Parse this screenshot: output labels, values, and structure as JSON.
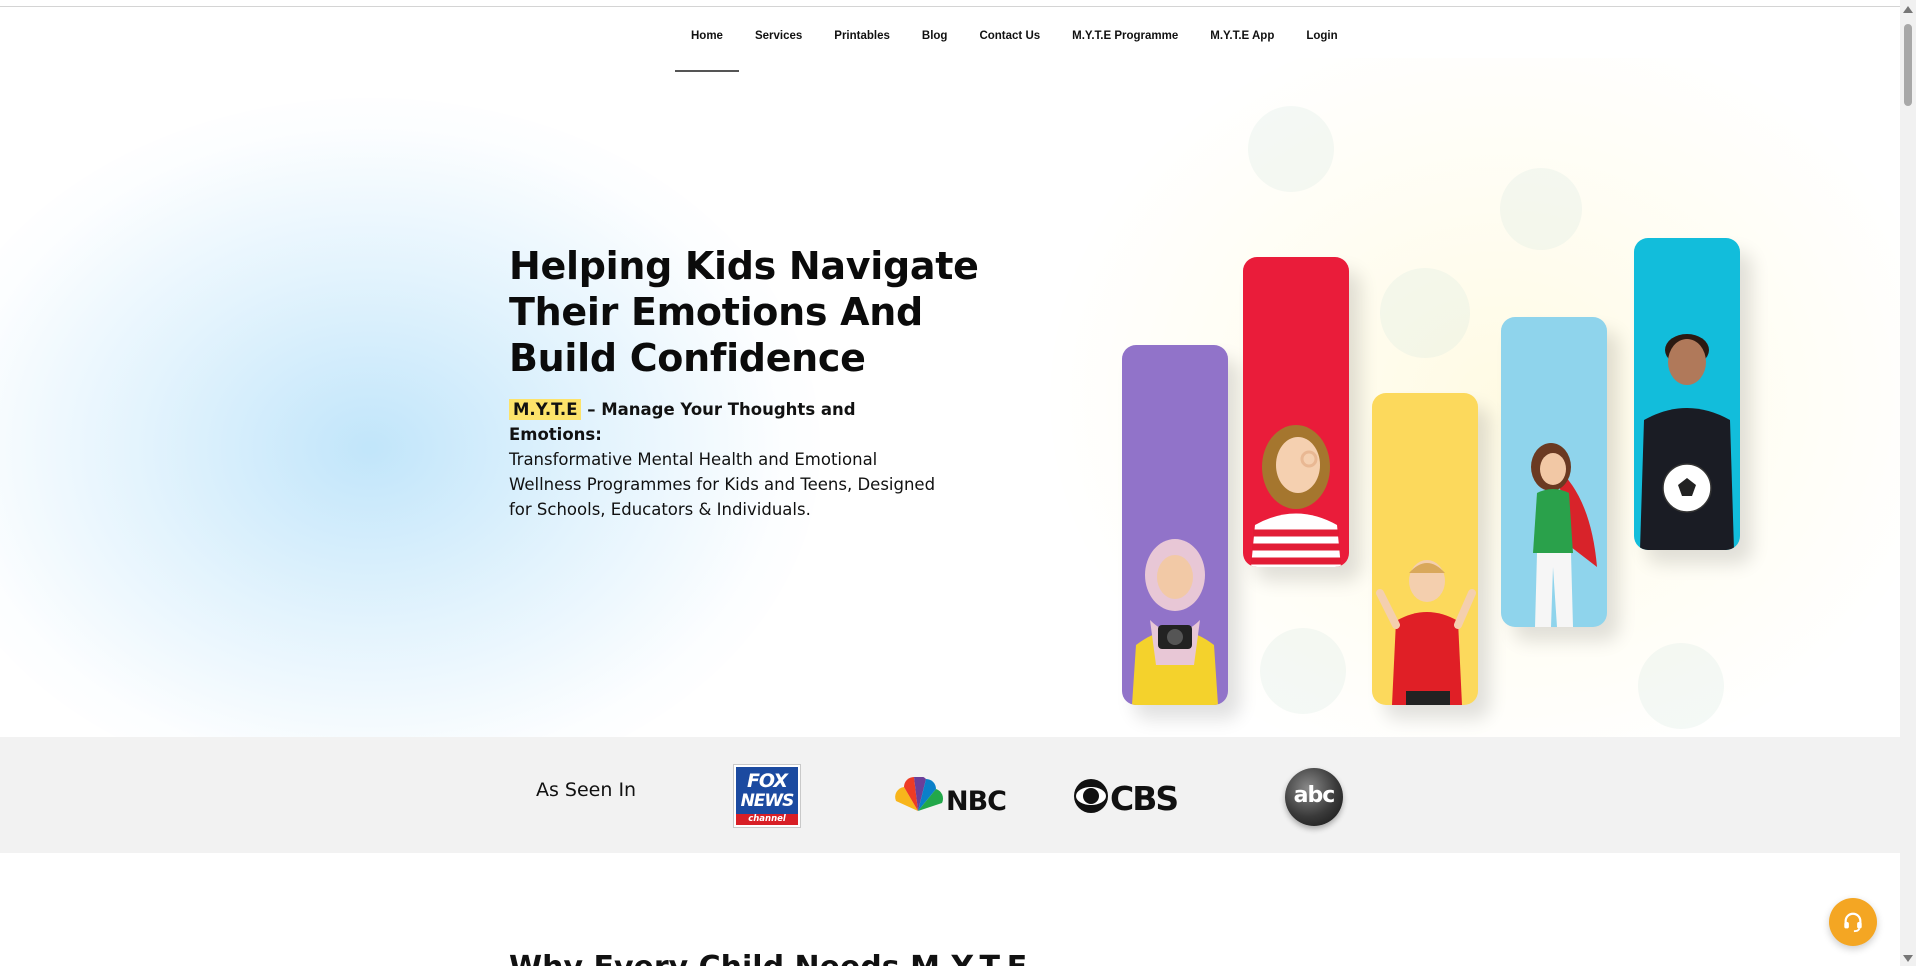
{
  "nav": {
    "items": [
      {
        "label": "Home",
        "active": true
      },
      {
        "label": "Services"
      },
      {
        "label": "Printables"
      },
      {
        "label": "Blog"
      },
      {
        "label": "Contact Us"
      },
      {
        "label": "M.Y.T.E Programme"
      },
      {
        "label": "M.Y.T.E App"
      },
      {
        "label": "Login"
      }
    ]
  },
  "hero": {
    "title_lines": [
      "Helping Kids Navigate",
      "Their Emotions And",
      "Build Confidence"
    ],
    "tag": "M.Y.T.E",
    "lead": " – Manage Your Thoughts and Emotions:",
    "body": "Transformative Mental Health and Emotional Wellness Programmes for Kids and Teens, Designed for Schools, Educators & Individuals."
  },
  "pillars": {
    "colors": [
      "#9173c9",
      "#ea1c3a",
      "#fcd95c",
      "#8fd4ec",
      "#12bddb"
    ]
  },
  "seen_in": {
    "label": "As Seen In",
    "fox": {
      "line1": "FOX",
      "line2": "NEWS",
      "line3": "channel"
    },
    "nbc": "NBC",
    "cbs": "CBS",
    "abc": "abc"
  },
  "next_section": {
    "title": "Why Every Child Needs M.Y.T.E"
  },
  "colors": {
    "highlight": "#fde36a",
    "help_button": "#f4a623"
  }
}
